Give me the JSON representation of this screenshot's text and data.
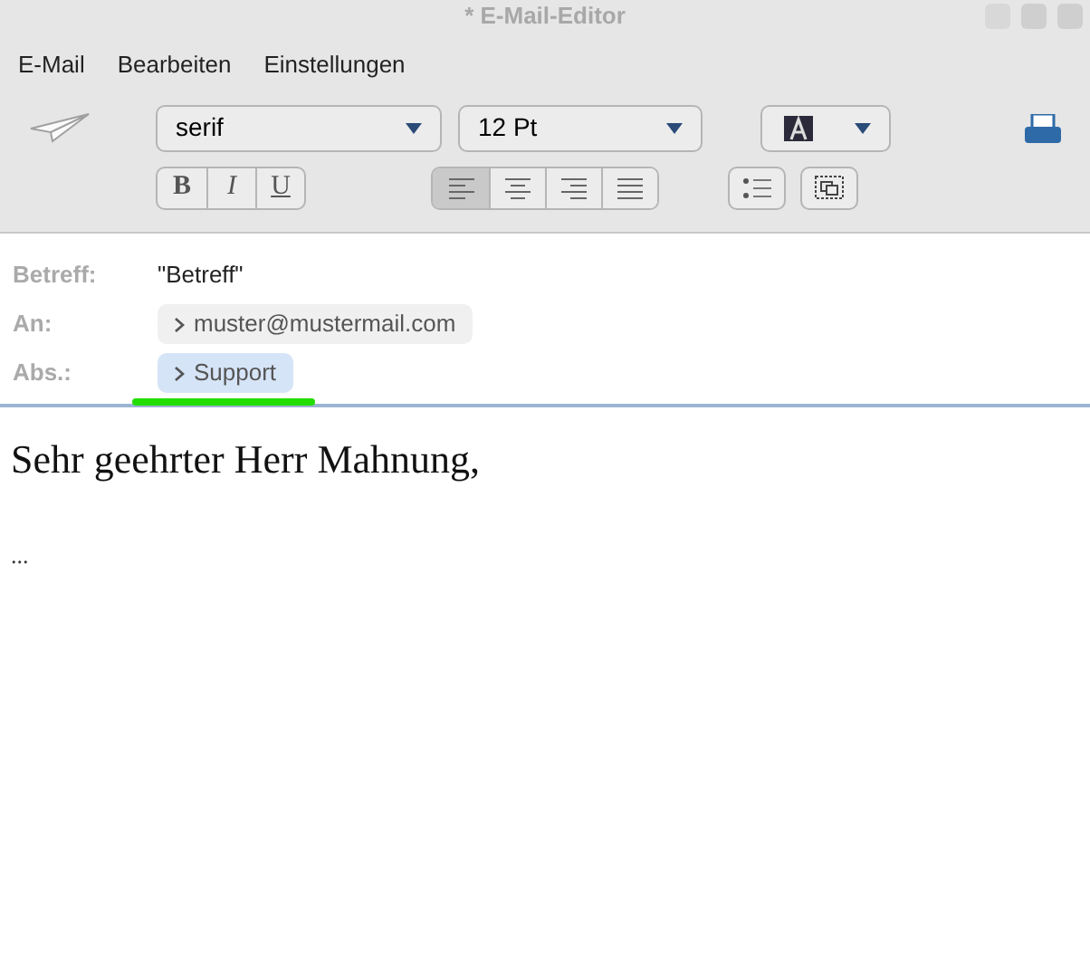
{
  "window": {
    "title": "* E-Mail-Editor"
  },
  "menu": [
    "E-Mail",
    "Bearbeiten",
    "Einstellungen"
  ],
  "toolbar": {
    "font": "serif",
    "size": "12 Pt",
    "styles": [
      {
        "label": "B",
        "kind": "bold"
      },
      {
        "label": "I",
        "kind": "italic"
      },
      {
        "label": "U",
        "kind": "underline"
      }
    ],
    "alignment": [
      {
        "kind": "left",
        "selected": true
      },
      {
        "kind": "center",
        "selected": false
      },
      {
        "kind": "right",
        "selected": false
      },
      {
        "kind": "justify",
        "selected": false
      }
    ]
  },
  "fields": [
    {
      "label": "Betreff:",
      "value": "\"Betreff\"",
      "kind": "text"
    },
    {
      "label": "An:",
      "value": "muster@mustermail.com",
      "kind": "chip"
    },
    {
      "label": "Abs.:",
      "value": "Support",
      "kind": "chip",
      "highlighted": true
    }
  ],
  "body": [
    "Sehr geehrter Herr Mahnung,",
    "..."
  ]
}
